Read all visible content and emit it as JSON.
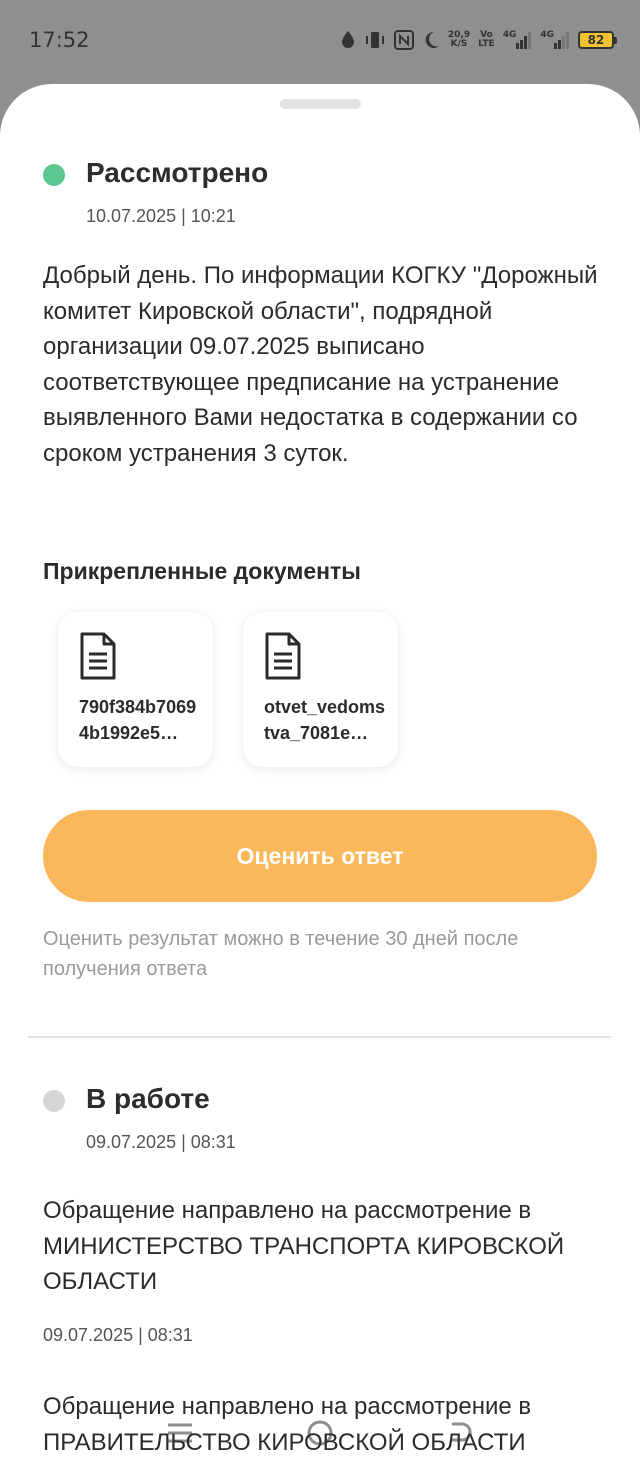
{
  "status_bar": {
    "time": "17:52",
    "net_speed_top": "20,9",
    "net_speed_bottom": "K/S",
    "volte_top": "Vo",
    "volte_bottom": "LTE",
    "signal1": "4G",
    "signal2": "4G",
    "battery": "82"
  },
  "entries": [
    {
      "status": "Рассмотрено",
      "status_color": "#5cc890",
      "date": "10.07.2025 | 10:21",
      "text": "Добрый день. По информации КОГКУ \"Дорожный комитет Кировской области\", подрядной организации 09.07.2025 выписано соответствующее предписание на устранение выявленного Вами недостатка в содержании со сроком устранения 3 суток.",
      "documents_title": "Прикрепленные документы",
      "documents": [
        {
          "name": "790f384b70694b1992e5…"
        },
        {
          "name": "otvet_vedomstva_7081e…"
        }
      ],
      "rate_button": "Оценить ответ",
      "rate_hint": "Оценить результат можно в течение 30 дней после получения ответа"
    },
    {
      "status": "В работе",
      "status_color": "#d6d6d6",
      "date": "09.07.2025 | 08:31",
      "messages": [
        {
          "text": "Обращение направлено на рассмотрение в МИНИСТЕРСТВО ТРАНСПОРТА КИРОВСКОЙ ОБЛАСТИ",
          "date": "09.07.2025 | 08:31"
        },
        {
          "text": "Обращение направлено на рассмотрение в ПРАВИТЕЛЬСТВО КИРОВСКОЙ ОБЛАСТИ"
        }
      ]
    }
  ]
}
